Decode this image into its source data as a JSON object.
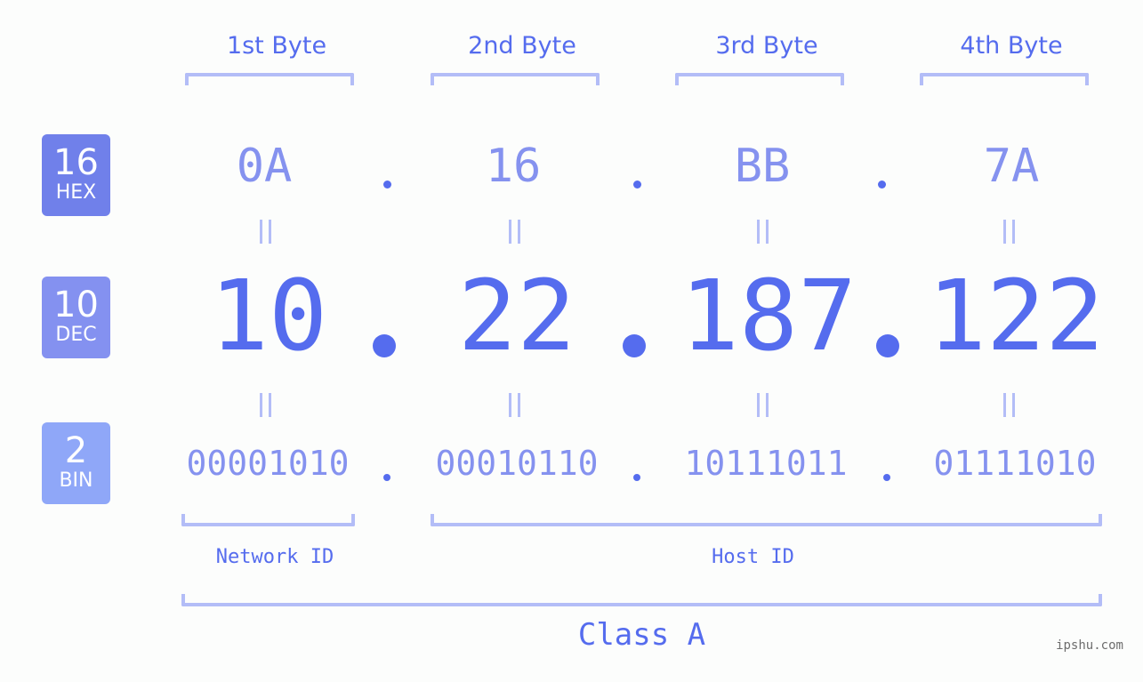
{
  "colors": {
    "background": "#fcfdfc",
    "primary": "#556cee",
    "secondary_text": "#8592ef",
    "bracket": "#b3bdf7",
    "badge_hex": "#7080ea",
    "badge_dec": "#8491f0",
    "badge_bin": "#8fa7f8",
    "watermark": "#6d6d6d"
  },
  "byte_headers": [
    "1st Byte",
    "2nd Byte",
    "3rd Byte",
    "4th Byte"
  ],
  "badges": {
    "hex": {
      "number": "16",
      "label": "HEX"
    },
    "dec": {
      "number": "10",
      "label": "DEC"
    },
    "bin": {
      "number": "2",
      "label": "BIN"
    }
  },
  "ip": {
    "hex": [
      "0A",
      "16",
      "BB",
      "7A"
    ],
    "dec": [
      "10",
      "22",
      "187",
      "122"
    ],
    "bin": [
      "00001010",
      "00010110",
      "10111011",
      "01111010"
    ]
  },
  "labels": {
    "network_id": "Network ID",
    "host_id": "Host ID",
    "class": "Class A"
  },
  "watermark": "ipshu.com"
}
